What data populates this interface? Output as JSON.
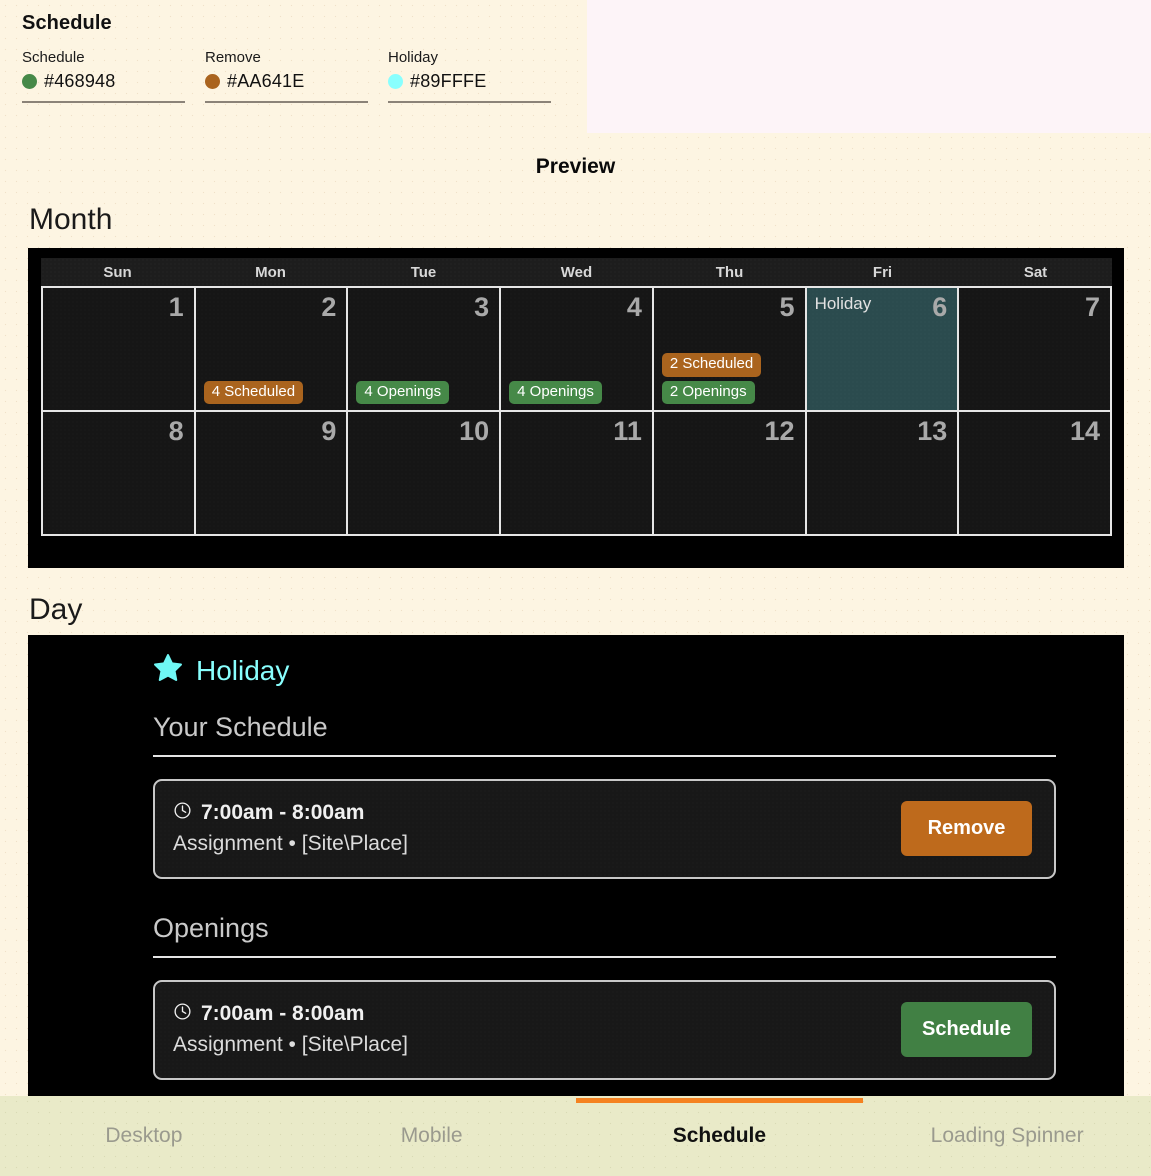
{
  "swatch_panel": {
    "title": "Schedule",
    "items": [
      {
        "label": "Schedule",
        "hex": "#468948"
      },
      {
        "label": "Remove",
        "hex": "#AA641E"
      },
      {
        "label": "Holiday",
        "hex": "#89FFFE"
      }
    ]
  },
  "preview": {
    "title": "Preview"
  },
  "month_section": {
    "heading": "Month",
    "weekdays": [
      "Sun",
      "Mon",
      "Tue",
      "Wed",
      "Thu",
      "Fri",
      "Sat"
    ],
    "weeks": [
      [
        {
          "day": "1",
          "holiday": "",
          "badges": []
        },
        {
          "day": "2",
          "holiday": "",
          "badges": [
            {
              "text": "4 Scheduled",
              "color": "#AA641E"
            }
          ]
        },
        {
          "day": "3",
          "holiday": "",
          "badges": [
            {
              "text": "4 Openings",
              "color": "#468948"
            }
          ]
        },
        {
          "day": "4",
          "holiday": "",
          "badges": [
            {
              "text": "4 Openings",
              "color": "#468948"
            }
          ]
        },
        {
          "day": "5",
          "holiday": "",
          "badges": [
            {
              "text": "2 Scheduled",
              "color": "#AA641E"
            },
            {
              "text": "2 Openings",
              "color": "#468948"
            }
          ]
        },
        {
          "day": "6",
          "holiday": "Holiday",
          "badges": []
        },
        {
          "day": "7",
          "holiday": "",
          "badges": []
        }
      ],
      [
        {
          "day": "8",
          "holiday": "",
          "badges": []
        },
        {
          "day": "9",
          "holiday": "",
          "badges": []
        },
        {
          "day": "10",
          "holiday": "",
          "badges": []
        },
        {
          "day": "11",
          "holiday": "",
          "badges": []
        },
        {
          "day": "12",
          "holiday": "",
          "badges": []
        },
        {
          "day": "13",
          "holiday": "",
          "badges": []
        },
        {
          "day": "14",
          "holiday": "",
          "badges": []
        }
      ]
    ]
  },
  "day_section": {
    "heading": "Day",
    "holiday_label": "Holiday",
    "holiday_color": "#89FFFE",
    "groups": [
      {
        "title": "Your Schedule",
        "card": {
          "time": "7:00am - 8:00am",
          "detail": "Assignment • [Site\\Place]",
          "button_label": "Remove",
          "button_color": "#AA641E"
        }
      },
      {
        "title": "Openings",
        "card": {
          "time": "7:00am - 8:00am",
          "detail": "Assignment • [Site\\Place]",
          "button_label": "Schedule",
          "button_color": "#468948"
        }
      }
    ]
  },
  "tabbar": {
    "tabs": [
      {
        "label": "Desktop",
        "active": false
      },
      {
        "label": "Mobile",
        "active": false
      },
      {
        "label": "Schedule",
        "active": true
      },
      {
        "label": "Loading Spinner",
        "active": false
      }
    ],
    "indicator_color": "#F58220"
  }
}
